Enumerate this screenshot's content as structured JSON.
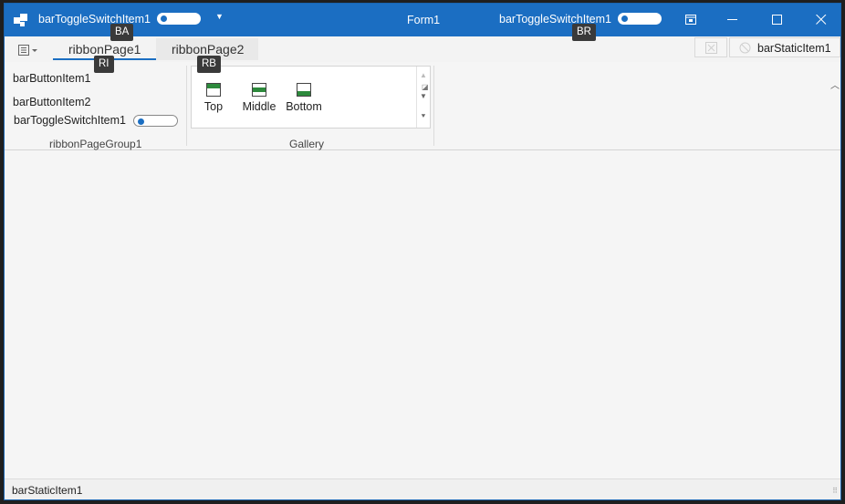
{
  "title_bar": {
    "qat_toggle_label": "barToggleSwitchItem1",
    "form_title": "Form1",
    "right_toggle_label": "barToggleSwitchItem1"
  },
  "keytips": {
    "ba": "BA",
    "br": "BR",
    "ri": "RI",
    "rb": "RB"
  },
  "ribbon": {
    "tabs": [
      "ribbonPage1",
      "ribbonPage2"
    ],
    "header_static_item": "barStaticItem1",
    "group1": {
      "items": [
        "barButtonItem1",
        "barButtonItem2"
      ],
      "toggle_label": "barToggleSwitchItem1",
      "caption": "ribbonPageGroup1"
    },
    "gallery": {
      "items": [
        "Top",
        "Middle",
        "Bottom"
      ],
      "caption": "Gallery"
    }
  },
  "status_bar": {
    "label": "barStaticItem1"
  },
  "colors": {
    "accent": "#1b6ec2",
    "gallery_bar": "#2d8a3c"
  }
}
